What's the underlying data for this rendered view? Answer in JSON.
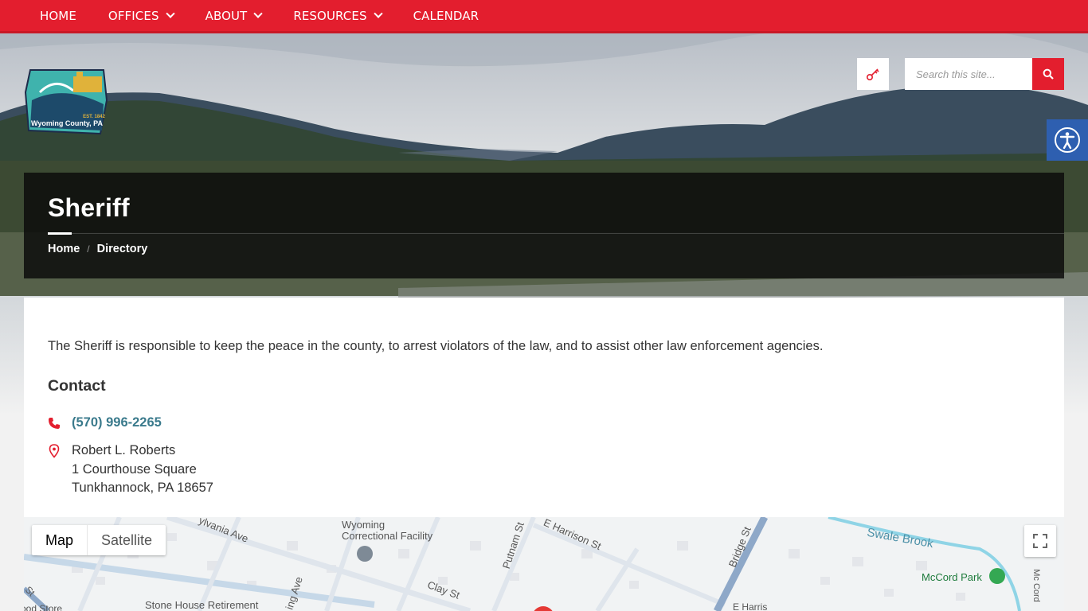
{
  "nav": {
    "items": [
      {
        "label": "HOME",
        "dropdown": false
      },
      {
        "label": "OFFICES",
        "dropdown": true
      },
      {
        "label": "ABOUT",
        "dropdown": true
      },
      {
        "label": "RESOURCES",
        "dropdown": true
      },
      {
        "label": "CALENDAR",
        "dropdown": false
      }
    ]
  },
  "brand": {
    "logo_text": "Wyoming County, PA",
    "logo_year": "EST. 1842"
  },
  "search": {
    "placeholder": "Search this site..."
  },
  "page": {
    "title": "Sheriff"
  },
  "breadcrumbs": [
    {
      "label": "Home"
    },
    {
      "label": "Directory"
    }
  ],
  "content": {
    "description": "The Sheriff is responsible to keep the peace in the county, to arrest violators of the law, and to assist other law enforcement agencies.",
    "contact_heading": "Contact",
    "phone": "(570) 996-2265",
    "address": [
      "Robert L. Roberts",
      "1 Courthouse Square",
      "Tunkhannock, PA 18657"
    ]
  },
  "map": {
    "toggle": {
      "map": "Map",
      "satellite": "Satellite"
    },
    "labels": {
      "sylvania": "ylvania Ave",
      "wyoming": "Wyoming",
      "correctional": "Correctional Facility",
      "putnam": "Putnam St",
      "harrison": "E Harrison St",
      "bridge": "Bridge St",
      "swale": "Swale Brook",
      "mccord_park": "McCord Park",
      "mccord_rd": "Mc Cord",
      "clay": "Clay St",
      "ave": "ing Ave",
      "stone": "Stone House Retirement",
      "store": "ood Store",
      "st_left": "St",
      "e_harrison2": "E Harris"
    }
  },
  "colors": {
    "brand_red": "#e31e2e",
    "link_teal": "#3a7a8c",
    "access_blue": "#2e5fb0"
  }
}
